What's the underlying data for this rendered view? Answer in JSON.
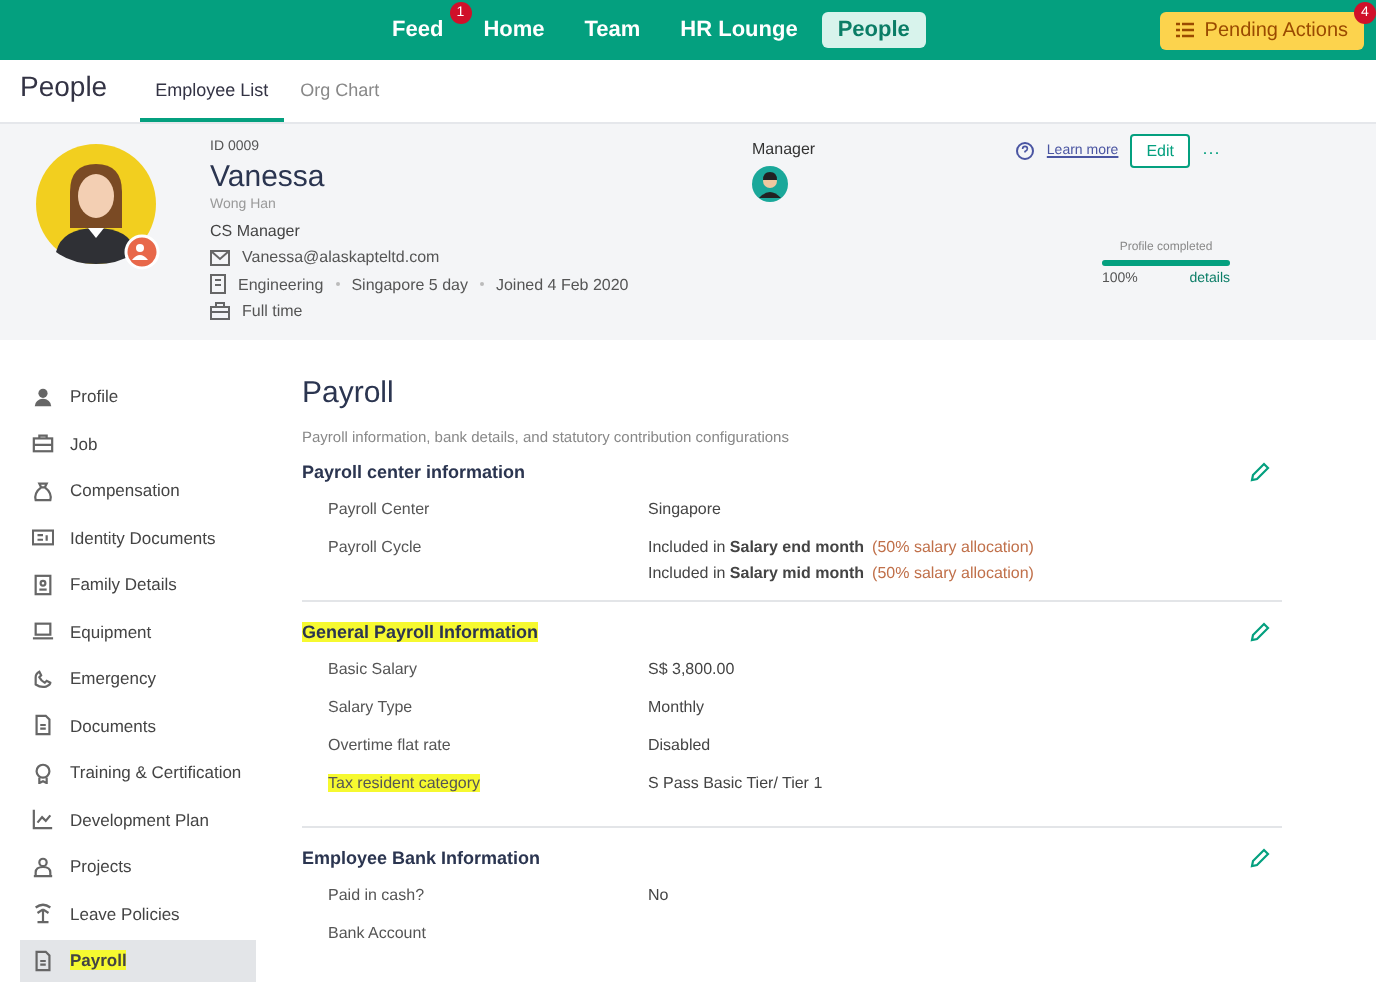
{
  "top_nav": {
    "items": [
      {
        "label": "Feed",
        "selected": false,
        "badge": "1"
      },
      {
        "label": "Home",
        "selected": false
      },
      {
        "label": "Team",
        "selected": false
      },
      {
        "label": "HR Lounge",
        "selected": false
      },
      {
        "label": "People",
        "selected": true
      }
    ],
    "pending_actions": {
      "label": "Pending Actions",
      "badge": "4"
    }
  },
  "sub_header": {
    "title": "People",
    "tabs": [
      {
        "label": "Employee List",
        "selected": true
      },
      {
        "label": "Org Chart",
        "selected": false
      }
    ]
  },
  "profile": {
    "id": "ID 0009",
    "name": "Vanessa",
    "alt_name": "Wong Han",
    "role": "CS Manager",
    "email": "Vanessa@alaskapteltd.com",
    "department": "Engineering",
    "schedule": "Singapore 5 day",
    "joined": "Joined 4 Feb 2020",
    "employment": "Full time",
    "manager_label": "Manager",
    "learn_more": "Learn more",
    "edit": "Edit",
    "more": "···",
    "completion": {
      "label": "Profile completed",
      "level": 1.0,
      "percent": "100%",
      "details": "details"
    }
  },
  "sidebar": {
    "items": [
      {
        "label": "Profile",
        "selected": false,
        "highlighted": false
      },
      {
        "label": "Job",
        "selected": false,
        "highlighted": false
      },
      {
        "label": "Compensation",
        "selected": false,
        "highlighted": false
      },
      {
        "label": "Identity Documents",
        "selected": false,
        "highlighted": false
      },
      {
        "label": "Family Details",
        "selected": false,
        "highlighted": false
      },
      {
        "label": "Equipment",
        "selected": false,
        "highlighted": false
      },
      {
        "label": "Emergency",
        "selected": false,
        "highlighted": false
      },
      {
        "label": "Documents",
        "selected": false,
        "highlighted": false
      },
      {
        "label": "Training & Certification",
        "selected": false,
        "highlighted": false
      },
      {
        "label": "Development Plan",
        "selected": false,
        "highlighted": false
      },
      {
        "label": "Projects",
        "selected": false,
        "highlighted": false
      },
      {
        "label": "Leave Policies",
        "selected": false,
        "highlighted": false
      },
      {
        "label": "Payroll",
        "selected": true,
        "highlighted": true
      }
    ]
  },
  "content": {
    "title": "Payroll",
    "subtitle": "Payroll information, bank details, and statutory contribution configurations",
    "sections": [
      {
        "title": "Payroll center information",
        "highlighted": false,
        "rows": [
          {
            "label": "Payroll Center",
            "highlighted": false,
            "values": [
              {
                "text": "Singapore"
              }
            ]
          },
          {
            "label": "Payroll Cycle",
            "highlighted": false,
            "values": [
              {
                "text": "Included in **Salary end month**",
                "note": "(50% salary allocation)"
              },
              {
                "text": "Included in **Salary mid month**",
                "note": "(50% salary allocation)"
              }
            ]
          }
        ]
      },
      {
        "title": "General Payroll Information",
        "highlighted": true,
        "rows": [
          {
            "label": "Basic Salary",
            "highlighted": false,
            "values": [
              {
                "text": "S$ 3,800.00"
              }
            ]
          },
          {
            "label": "Salary Type",
            "highlighted": false,
            "values": [
              {
                "text": "Monthly"
              }
            ]
          },
          {
            "label": "Overtime flat rate",
            "highlighted": false,
            "values": [
              {
                "text": "Disabled"
              }
            ]
          },
          {
            "label": "Tax resident category",
            "highlighted": true,
            "values": [
              {
                "text": "S Pass Basic Tier/ Tier 1"
              }
            ]
          }
        ]
      },
      {
        "title": "Employee Bank Information",
        "highlighted": false,
        "rows": [
          {
            "label": "Paid in cash?",
            "highlighted": false,
            "values": [
              {
                "text": "No"
              }
            ]
          },
          {
            "label": "Bank Account",
            "highlighted": false,
            "values": []
          }
        ]
      }
    ]
  }
}
